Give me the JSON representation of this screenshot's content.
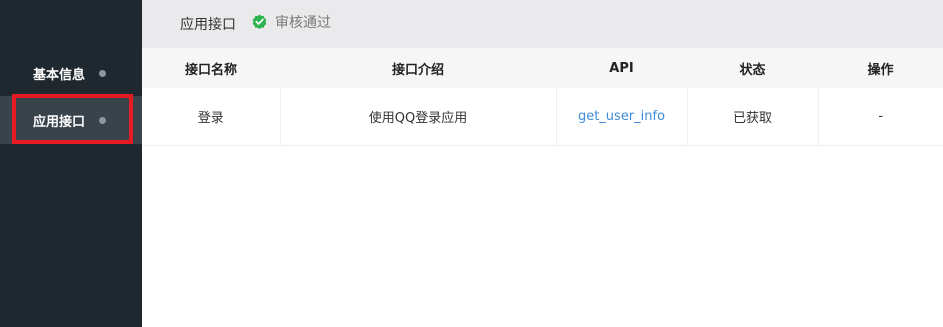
{
  "sidebar": {
    "items": [
      {
        "label": "基本信息"
      },
      {
        "label": "应用接口"
      }
    ]
  },
  "header": {
    "title": "应用接口",
    "status_text": "审核通过",
    "status_color": "#2cb34d"
  },
  "table": {
    "columns": [
      "接口名称",
      "接口介绍",
      "API",
      "状态",
      "操作"
    ],
    "rows": [
      {
        "name": "登录",
        "description": "使用QQ登录应用",
        "api": "get_user_info",
        "status": "已获取",
        "action": "-"
      }
    ]
  },
  "colors": {
    "sidebar_bg": "#1f282f",
    "active_item_bg": "#38434b",
    "highlight_border": "#e51b23",
    "link": "#3f8cd9"
  }
}
